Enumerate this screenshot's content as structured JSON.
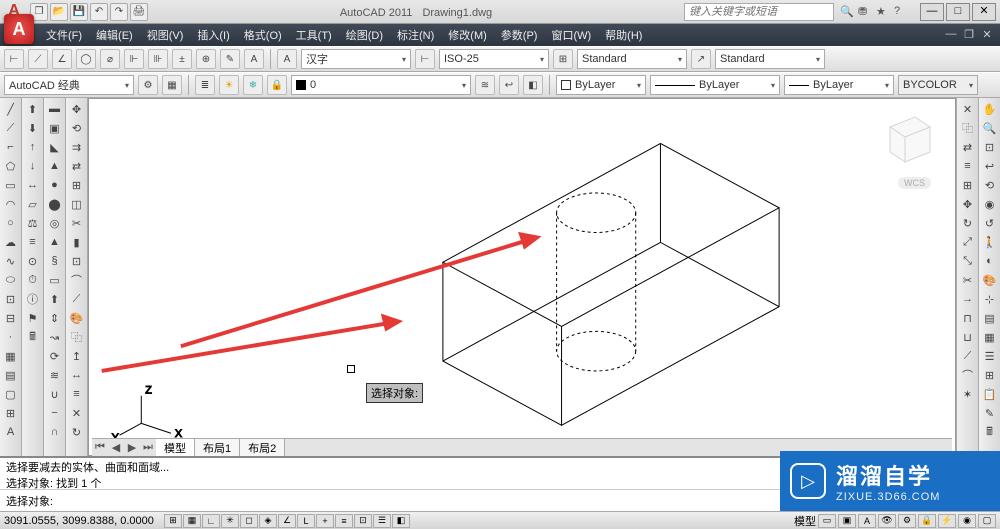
{
  "app": {
    "title": "AutoCAD 2011",
    "doc": "Drawing1.dwg",
    "search_placeholder": "键入关键字或短语"
  },
  "menus": [
    "文件(F)",
    "编辑(E)",
    "视图(V)",
    "插入(I)",
    "格式(O)",
    "工具(T)",
    "绘图(D)",
    "标注(N)",
    "修改(M)",
    "参数(P)",
    "窗口(W)",
    "帮助(H)"
  ],
  "row1": {
    "textstyle": "汉字",
    "dimstyle": "ISO-25",
    "tablestyle": "Standard",
    "mleaderstyle": "Standard"
  },
  "row2": {
    "workspace": "AutoCAD 经典",
    "layer": "0",
    "linetype_label": "ByLayer",
    "linetype2": "ByLayer",
    "lineweight": "ByLayer",
    "plotstyle": "BYCOLOR"
  },
  "viewcube": {
    "label": "WCS"
  },
  "tooltip": "选择对象:",
  "ucs": {
    "x": "X",
    "y": "Y",
    "z": "Z"
  },
  "tabs": {
    "model": "模型",
    "layout1": "布局1",
    "layout2": "布局2"
  },
  "cmd": {
    "hist1": "选择要减去的实体、曲面和面域...",
    "hist2": "选择对象: 找到 1 个",
    "prompt": "选择对象:"
  },
  "status": {
    "coords": "3091.0555, 3099.8388, 0.0000",
    "right_label": "模型"
  },
  "watermark": {
    "cn": "溜溜自学",
    "en": "ZIXUE.3D66.COM"
  },
  "icons": {
    "line": "╱",
    "circle": "○",
    "rect": "▭",
    "arc": "◠",
    "poly": "⬠",
    "ellipse": "⬭",
    "hatch": "▦",
    "text": "A",
    "point": "·",
    "spline": "∿",
    "move": "✥",
    "copy": "⿻",
    "rotate": "↻",
    "mirror": "⇄",
    "scale": "⤢",
    "trim": "✂",
    "extend": "→",
    "fillet": "⌒",
    "array": "⊞",
    "erase": "✕",
    "offset": "≡",
    "explode": "✶",
    "box": "▣",
    "sphere": "●",
    "cyl": "⬤",
    "cone": "▲",
    "torus": "◎",
    "extrude": "⬆",
    "union": "∪",
    "subtract": "−",
    "intersect": "∩",
    "zoom": "🔍",
    "pan": "✋",
    "orbit": "⟲"
  }
}
